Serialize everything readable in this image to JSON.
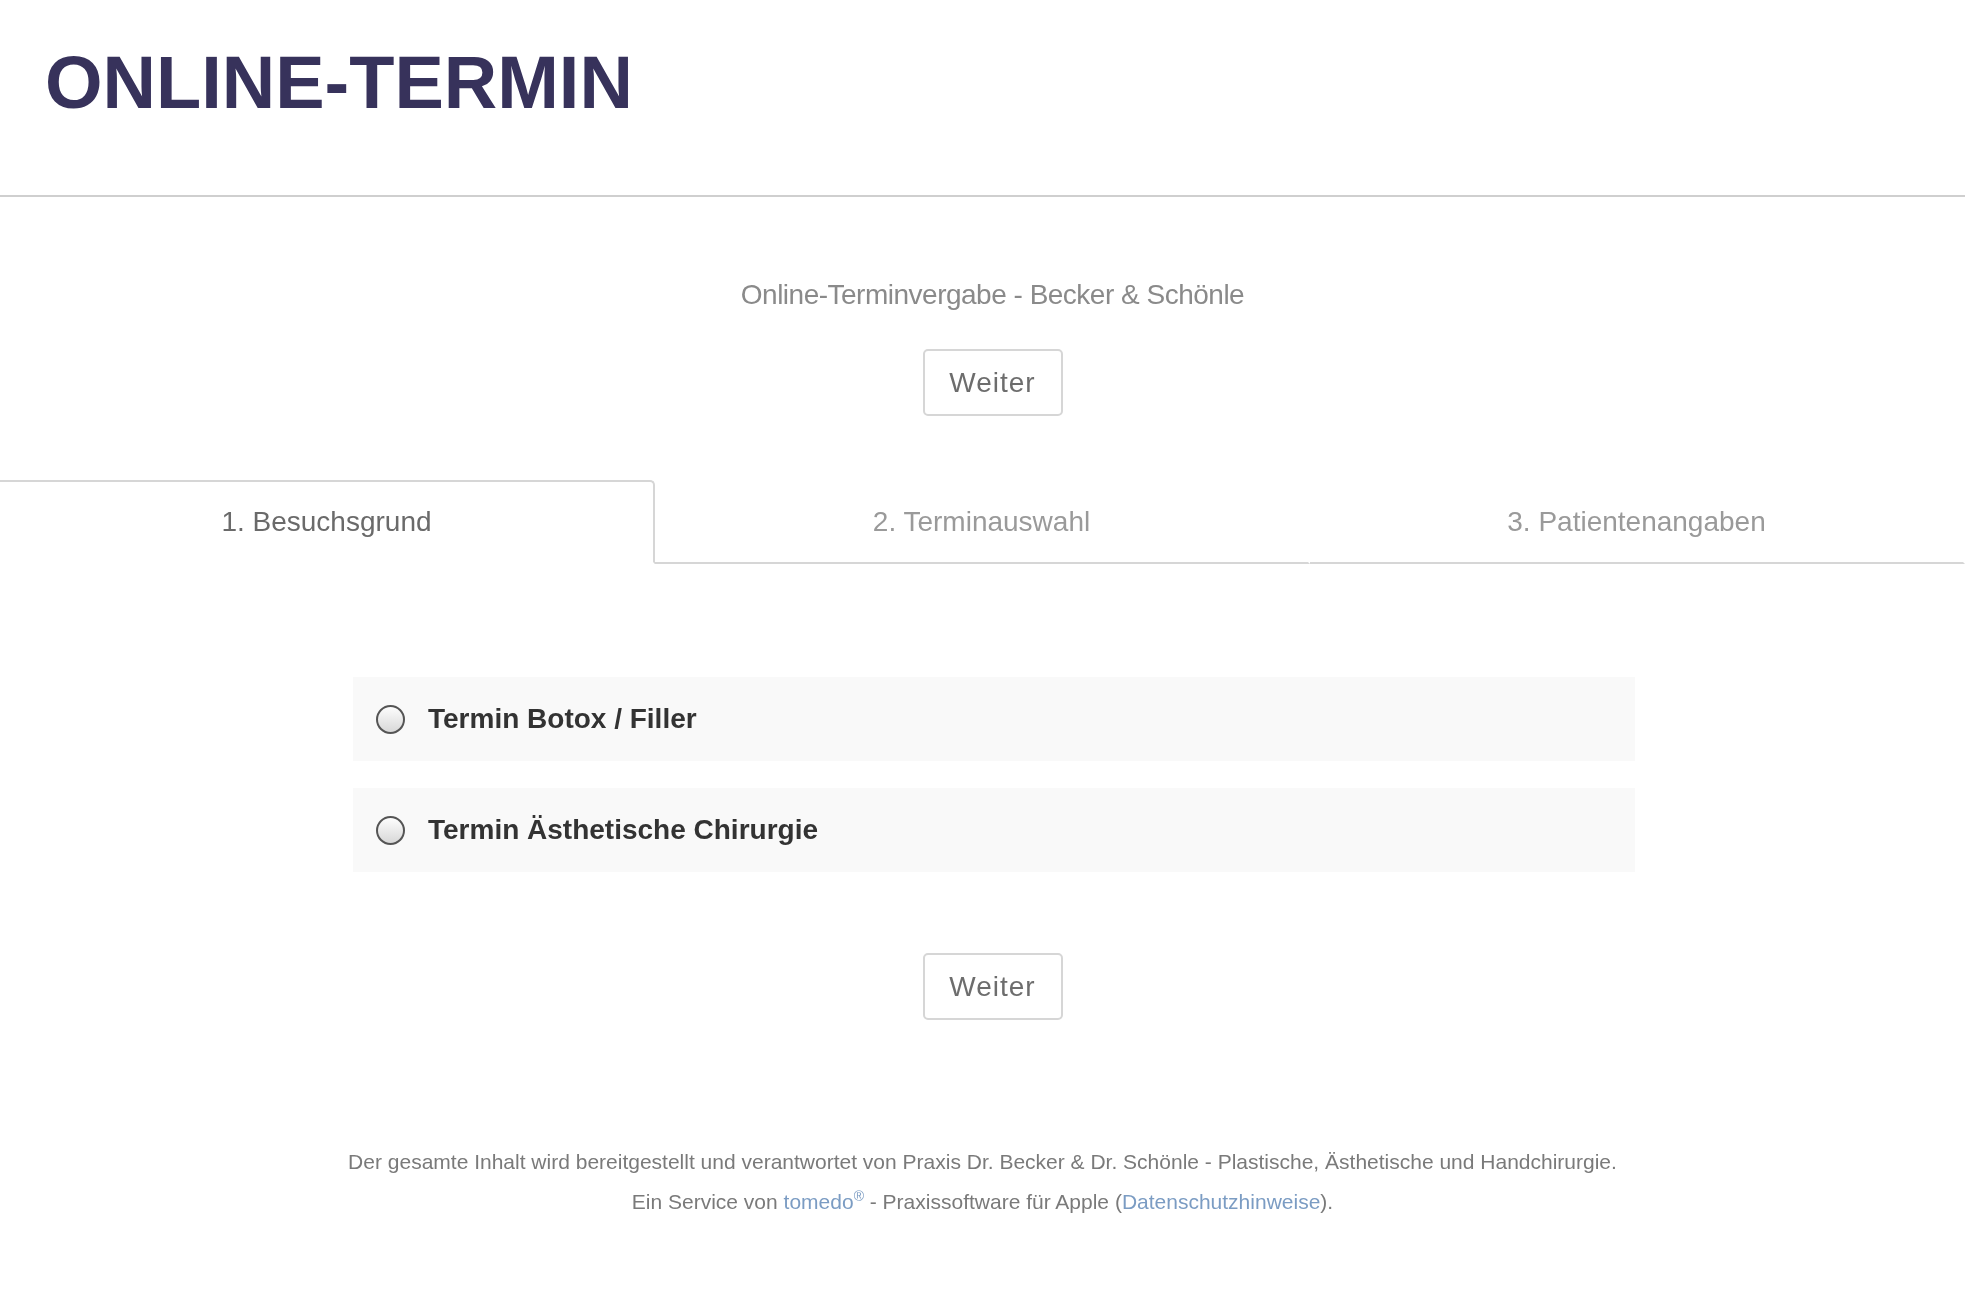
{
  "header": {
    "title": "ONLINE-TERMIN"
  },
  "intro": {
    "subtitle": "Online-Terminvergabe - Becker & Schönle",
    "button": "Weiter"
  },
  "tabs": [
    {
      "label": "1. Besuchsgrund",
      "selected": true
    },
    {
      "label": "2. Terminauswahl",
      "selected": false
    },
    {
      "label": "3. Patientenangaben",
      "selected": false
    }
  ],
  "options": [
    {
      "label": "Termin Botox / Filler",
      "selected": false
    },
    {
      "label": "Termin Ästhetische Chirurgie",
      "selected": false
    }
  ],
  "bottom_button": "Weiter",
  "footer": {
    "line_1": "Der gesamte Inhalt wird bereitgestellt und verantwortet von Praxis Dr. Becker & Dr. Schönle - Plastische, Ästhetische und Handchirurgie.",
    "line_2": {
      "before": "Ein Service von ",
      "link": "tomedo$^{®}$",
      "middle": " - Praxissoftware für Apple (",
      "link_2": "Datenschutzhinweise",
      "after": ")."
    }
  }
}
